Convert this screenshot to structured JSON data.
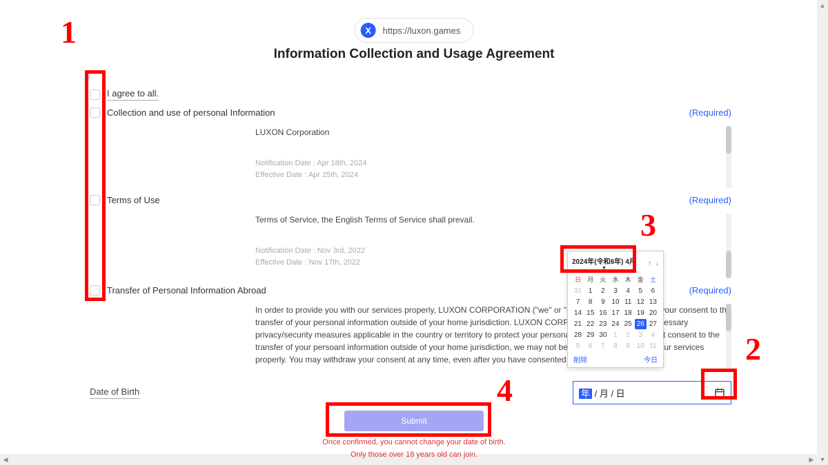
{
  "url": "https://luxon.games",
  "logo_letter": "X",
  "title": "Information Collection and Usage Agreement",
  "agree_all": "I agree to all.",
  "required_label": "(Required)",
  "sections": {
    "collection": {
      "label": "Collection and use of personal Information",
      "company": "LUXON Corporation",
      "meta1": "Notification Date : Apr 18th, 2024",
      "meta2": "Effective Date : Apr 25th, 2024"
    },
    "tou": {
      "label": "Terms of Use",
      "body": "Terms of Service, the English Terms of Service shall prevail.",
      "meta1": "Notification Date : Nov 3rd, 2022",
      "meta2": "Effective Date : Nov 17th, 2022"
    },
    "transfer": {
      "label": "Transfer of Personal Information Abroad",
      "body": "In order to provide you with our services properly, LUXON CORPORATION (\"we\" or \"us\") would like to obtaion your consent to the transfer of your personal information outside of your home jurisdiction. LUXON CORPORATION will take all necessary privacy/security measures applicable in the country or territory to protect your personal information. If you do not consent to the transfer of your persoanl information outside of your home jurisdiction, we may not be able to provide you with our services properly. You may withdraw your consent at any time, even after you have consented to the transfer"
    }
  },
  "dob": {
    "label": "Date of Birth",
    "value_year": "年",
    "value_rest": " / 月 / 日"
  },
  "submit": "Submit",
  "footer1": "Once confirmed, you cannot change your date of birth.",
  "footer2": "Only those over 18 years old can join.",
  "calendar": {
    "month_label": "2024年(令和6年) 4月",
    "dow": [
      "日",
      "月",
      "火",
      "水",
      "木",
      "金",
      "土"
    ],
    "days": [
      {
        "n": "31",
        "c": "prev"
      },
      {
        "n": "1"
      },
      {
        "n": "2"
      },
      {
        "n": "3"
      },
      {
        "n": "4"
      },
      {
        "n": "5"
      },
      {
        "n": "6"
      },
      {
        "n": "7"
      },
      {
        "n": "8"
      },
      {
        "n": "9"
      },
      {
        "n": "10"
      },
      {
        "n": "11"
      },
      {
        "n": "12"
      },
      {
        "n": "13"
      },
      {
        "n": "14"
      },
      {
        "n": "15"
      },
      {
        "n": "16"
      },
      {
        "n": "17"
      },
      {
        "n": "18"
      },
      {
        "n": "19"
      },
      {
        "n": "20"
      },
      {
        "n": "21"
      },
      {
        "n": "22"
      },
      {
        "n": "23"
      },
      {
        "n": "24"
      },
      {
        "n": "25"
      },
      {
        "n": "26",
        "c": "sel"
      },
      {
        "n": "27"
      },
      {
        "n": "28"
      },
      {
        "n": "29"
      },
      {
        "n": "30"
      },
      {
        "n": "1",
        "c": "next"
      },
      {
        "n": "2",
        "c": "next"
      },
      {
        "n": "3",
        "c": "next"
      },
      {
        "n": "4",
        "c": "next"
      },
      {
        "n": "5",
        "c": "next"
      },
      {
        "n": "6",
        "c": "next"
      },
      {
        "n": "7",
        "c": "next"
      },
      {
        "n": "8",
        "c": "next"
      },
      {
        "n": "9",
        "c": "next"
      },
      {
        "n": "10",
        "c": "next"
      },
      {
        "n": "11",
        "c": "next"
      }
    ],
    "clear": "削除",
    "today": "今日"
  },
  "annotations": {
    "n1": "1",
    "n2": "2",
    "n3": "3",
    "n4": "4"
  }
}
